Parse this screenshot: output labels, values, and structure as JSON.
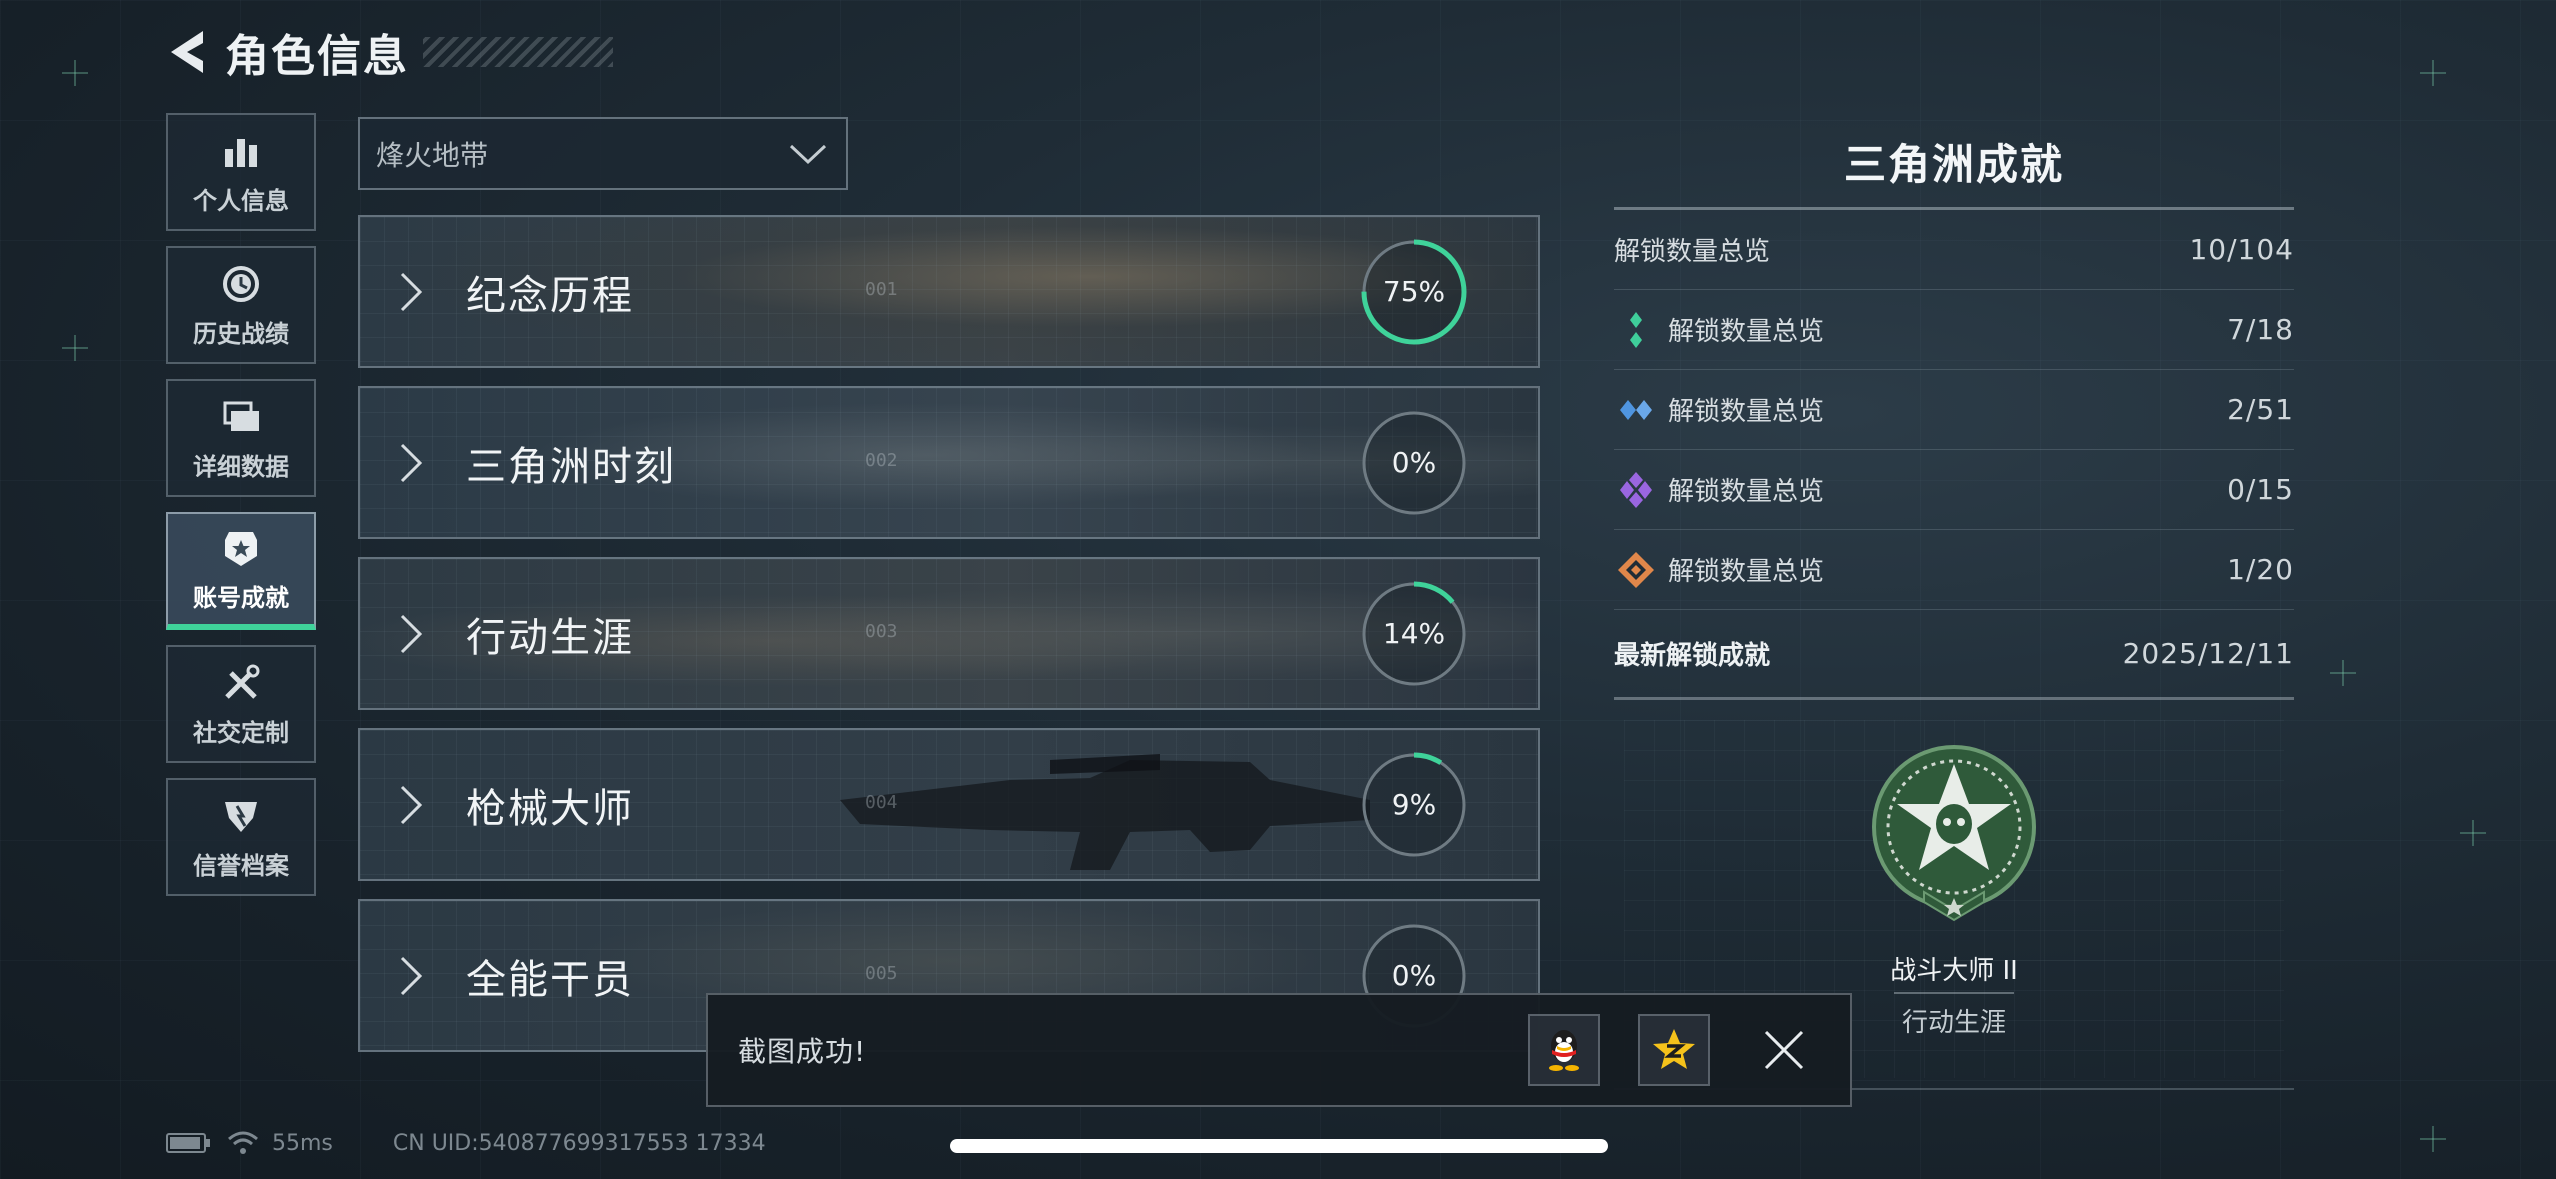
{
  "header": {
    "title": "角色信息"
  },
  "sidebar": {
    "items": [
      {
        "label": "个人信息",
        "icon": "bar-chart-icon",
        "active": false
      },
      {
        "label": "历史战绩",
        "icon": "history-clock-icon",
        "active": false
      },
      {
        "label": "详细数据",
        "icon": "folders-icon",
        "active": false
      },
      {
        "label": "账号成就",
        "icon": "achievement-badge-icon",
        "active": true
      },
      {
        "label": "社交定制",
        "icon": "tools-icon",
        "active": false
      },
      {
        "label": "信誉档案",
        "icon": "credit-shield-icon",
        "active": false
      }
    ]
  },
  "mode_select": {
    "value": "烽火地带"
  },
  "categories": [
    {
      "title": "纪念历程",
      "percent": 75,
      "percent_label": "75%",
      "index": "001"
    },
    {
      "title": "三角洲时刻",
      "percent": 0,
      "percent_label": "0%",
      "index": "002"
    },
    {
      "title": "行动生涯",
      "percent": 14,
      "percent_label": "14%",
      "index": "003"
    },
    {
      "title": "枪械大师",
      "percent": 9,
      "percent_label": "9%",
      "index": "004"
    },
    {
      "title": "全能干员",
      "percent": 0,
      "percent_label": "0%",
      "index": "005"
    }
  ],
  "panel": {
    "title": "三角洲成就",
    "total": {
      "label": "解锁数量总览",
      "value": "10/104"
    },
    "tiers": [
      {
        "label": "解锁数量总览",
        "value": "7/18",
        "color": "#3fcf9b"
      },
      {
        "label": "解锁数量总览",
        "value": "2/51",
        "color": "#4f95e0"
      },
      {
        "label": "解锁数量总览",
        "value": "0/15",
        "color": "#9a66e0"
      },
      {
        "label": "解锁数量总览",
        "value": "1/20",
        "color": "#e0874a"
      }
    ],
    "latest": {
      "label": "最新解锁成就",
      "date": "2025/12/11",
      "achievement_name": "战斗大师 II",
      "achievement_category": "行动生涯"
    }
  },
  "toast": {
    "message": "截图成功!"
  },
  "footer": {
    "ping": "55ms",
    "uid": "CN UID:540877699317553 17334"
  },
  "colors": {
    "accent": "#3fd39a",
    "ring_track": "#6f7b83"
  }
}
